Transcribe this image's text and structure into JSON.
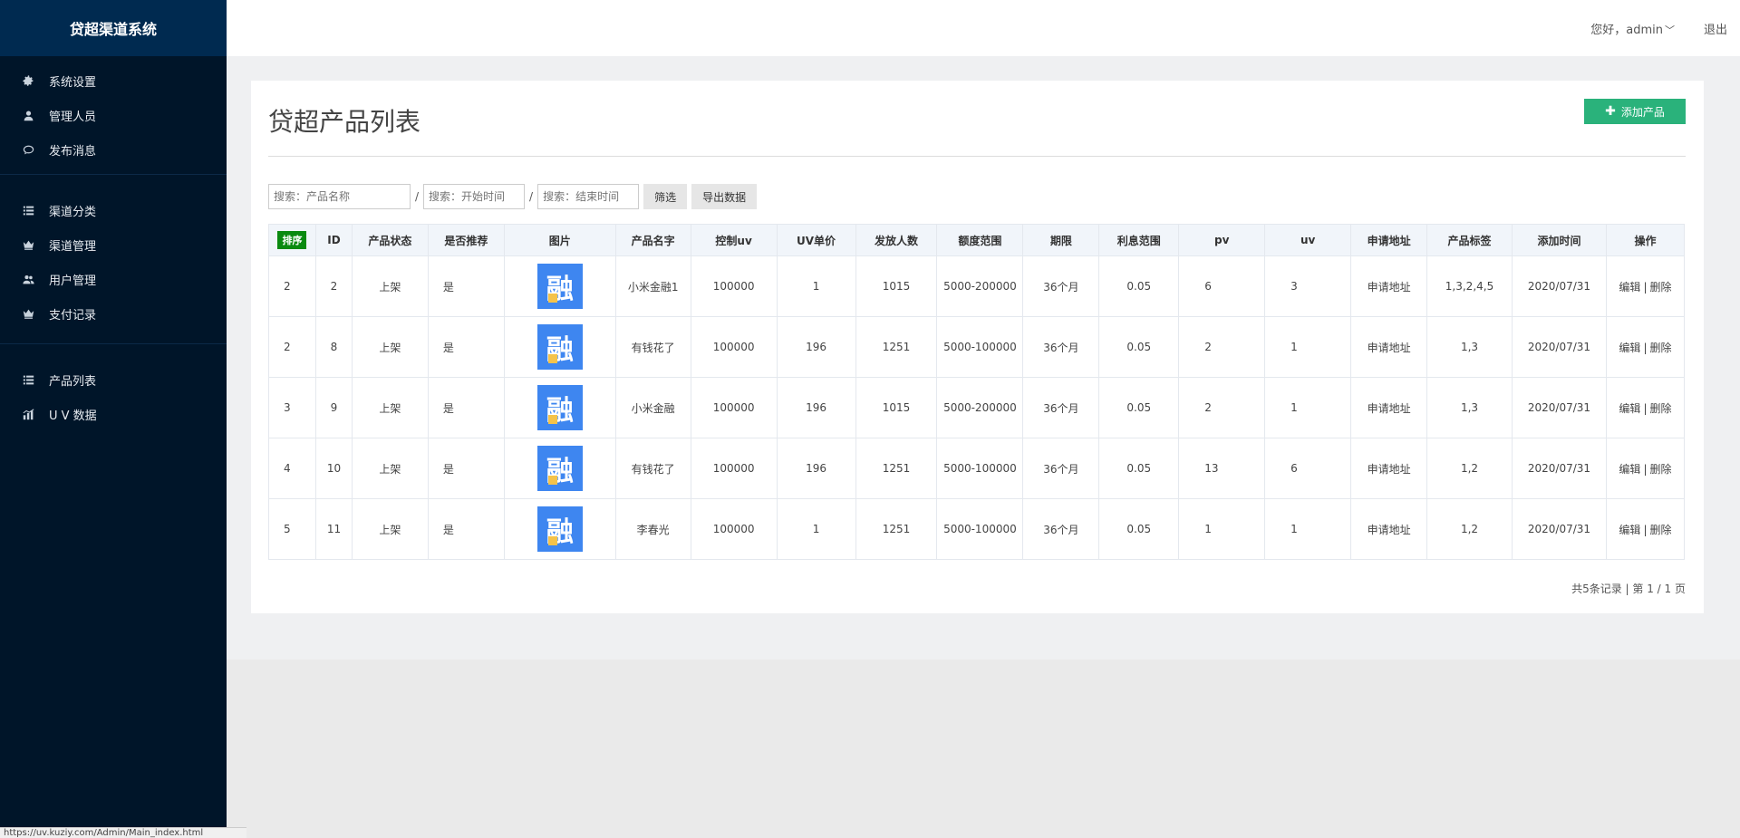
{
  "app": {
    "title": "贷超渠道系统"
  },
  "sidebar": {
    "groups": [
      {
        "items": [
          {
            "label": "系统设置",
            "icon": "gear-icon"
          },
          {
            "label": "管理人员",
            "icon": "user-icon"
          },
          {
            "label": "发布消息",
            "icon": "chat-icon"
          }
        ]
      },
      {
        "items": [
          {
            "label": "渠道分类",
            "icon": "list-icon"
          },
          {
            "label": "渠道管理",
            "icon": "crown-icon"
          },
          {
            "label": "用户管理",
            "icon": "users-icon"
          },
          {
            "label": "支付记录",
            "icon": "crown-icon"
          }
        ]
      },
      {
        "items": [
          {
            "label": "产品列表",
            "icon": "list-icon"
          },
          {
            "label": "U V 数据",
            "icon": "bar-chart-icon"
          }
        ]
      }
    ]
  },
  "header": {
    "greeting": "您好，admin",
    "logout": "退出"
  },
  "page": {
    "title": "贷超产品列表",
    "add_button": "添加产品"
  },
  "filters": {
    "name_placeholder": "搜索：产品名称",
    "start_placeholder": "搜索：开始时间",
    "end_placeholder": "搜索：结束时间",
    "separator": "/",
    "filter_button": "筛选",
    "export_button": "导出数据"
  },
  "table": {
    "columns": [
      "排序",
      "ID",
      "产品状态",
      "是否推荐",
      "图片",
      "产品名字",
      "控制uv",
      "UV单价",
      "发放人数",
      "额度范围",
      "期限",
      "利息范围",
      "pv",
      "uv",
      "申请地址",
      "产品标签",
      "添加时间",
      "操作"
    ],
    "thumb_glyph": "融",
    "rows": [
      {
        "sort": "2",
        "id": "2",
        "status": "上架",
        "recommend": "是",
        "name": "小米金融1",
        "ctrl_uv": "100000",
        "uv_price": "1",
        "issued": "1015",
        "amount": "5000-200000",
        "term": "36个月",
        "interest": "0.05",
        "pv": "6",
        "uv": "3",
        "apply": "申请地址",
        "tags": "1,3,2,4,5",
        "date": "2020/07/31",
        "edit": "编辑",
        "sep": "|",
        "del": "删除"
      },
      {
        "sort": "2",
        "id": "8",
        "status": "上架",
        "recommend": "是",
        "name": "有钱花了",
        "ctrl_uv": "100000",
        "uv_price": "196",
        "issued": "1251",
        "amount": "5000-100000",
        "term": "36个月",
        "interest": "0.05",
        "pv": "2",
        "uv": "1",
        "apply": "申请地址",
        "tags": "1,3",
        "date": "2020/07/31",
        "edit": "编辑",
        "sep": "|",
        "del": "删除"
      },
      {
        "sort": "3",
        "id": "9",
        "status": "上架",
        "recommend": "是",
        "name": "小米金融",
        "ctrl_uv": "100000",
        "uv_price": "196",
        "issued": "1015",
        "amount": "5000-200000",
        "term": "36个月",
        "interest": "0.05",
        "pv": "2",
        "uv": "1",
        "apply": "申请地址",
        "tags": "1,3",
        "date": "2020/07/31",
        "edit": "编辑",
        "sep": "|",
        "del": "删除"
      },
      {
        "sort": "4",
        "id": "10",
        "status": "上架",
        "recommend": "是",
        "name": "有钱花了",
        "ctrl_uv": "100000",
        "uv_price": "196",
        "issued": "1251",
        "amount": "5000-100000",
        "term": "36个月",
        "interest": "0.05",
        "pv": "13",
        "uv": "6",
        "apply": "申请地址",
        "tags": "1,2",
        "date": "2020/07/31",
        "edit": "编辑",
        "sep": "|",
        "del": "删除"
      },
      {
        "sort": "5",
        "id": "11",
        "status": "上架",
        "recommend": "是",
        "name": "李春光",
        "ctrl_uv": "100000",
        "uv_price": "1",
        "issued": "1251",
        "amount": "5000-100000",
        "term": "36个月",
        "interest": "0.05",
        "pv": "1",
        "uv": "1",
        "apply": "申请地址",
        "tags": "1,2",
        "date": "2020/07/31",
        "edit": "编辑",
        "sep": "|",
        "del": "删除"
      }
    ]
  },
  "pager": {
    "text": "共5条记录 | 第 1 / 1 页"
  },
  "statusbar": {
    "url": "https://uv.kuziy.com/Admin/Main_index.html"
  },
  "colors": {
    "sidebar_bg": "#001529",
    "accent_green": "#2ab27b",
    "sort_badge": "#0a8a10",
    "thumb_blue": "#3e86f0"
  }
}
